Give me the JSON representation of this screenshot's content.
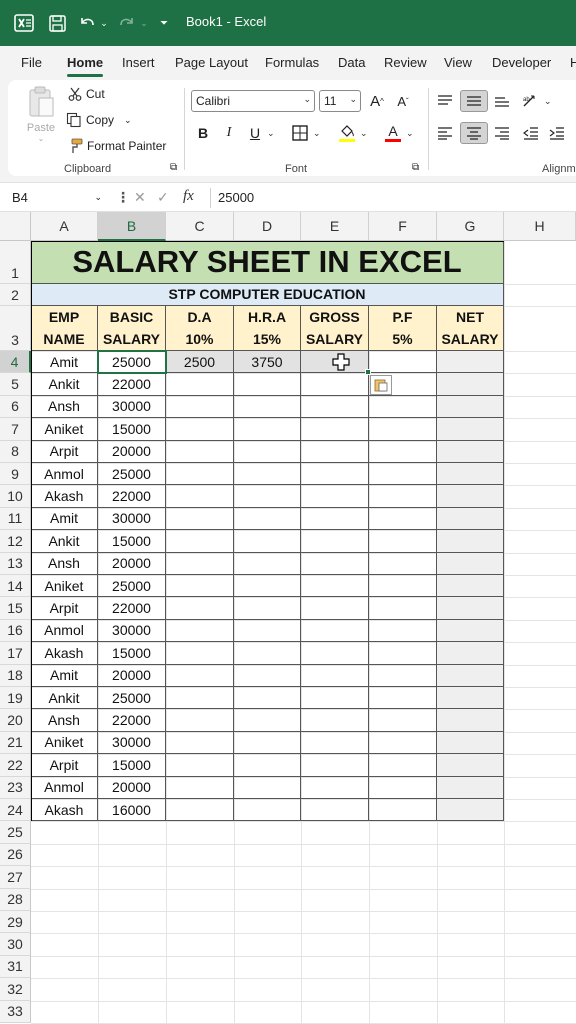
{
  "titlebar": {
    "title": "Book1  -  Excel"
  },
  "menu": {
    "tabs": [
      "File",
      "Home",
      "Insert",
      "Page Layout",
      "Formulas",
      "Data",
      "Review",
      "View",
      "Developer",
      "H"
    ]
  },
  "ribbon": {
    "clipboard": {
      "paste": "Paste",
      "cut": "Cut",
      "copy": "Copy",
      "format_painter": "Format Painter",
      "label": "Clipboard"
    },
    "font": {
      "font_name": "Calibri",
      "font_size": "11",
      "label": "Font",
      "bold": "B",
      "italic": "I",
      "underline": "U",
      "font_color_letter": "A"
    },
    "alignment_label": "Alignm"
  },
  "formula_bar": {
    "name_box": "B4",
    "fx": "fx",
    "value": "25000"
  },
  "columns": [
    "A",
    "B",
    "C",
    "D",
    "E",
    "F",
    "G",
    "H"
  ],
  "rows": [
    "1",
    "2",
    "3",
    "4",
    "5",
    "6",
    "7",
    "8",
    "9",
    "10",
    "11",
    "12",
    "13",
    "14",
    "15",
    "16",
    "17",
    "18",
    "19",
    "20",
    "21",
    "22",
    "23",
    "24",
    "25",
    "26",
    "27",
    "28",
    "29",
    "30",
    "31",
    "32",
    "33"
  ],
  "sheet": {
    "title": "SALARY SHEET IN EXCEL",
    "subtitle": "STP COMPUTER EDUCATION",
    "headers": [
      [
        "EMP",
        "NAME"
      ],
      [
        "BASIC",
        "SALARY"
      ],
      [
        "D.A",
        "10%"
      ],
      [
        "H.R.A",
        "15%"
      ],
      [
        "GROSS",
        "SALARY"
      ],
      [
        "P.F",
        "5%"
      ],
      [
        "NET",
        "SALARY"
      ]
    ],
    "data": [
      [
        "Amit",
        "25000",
        "2500",
        "3750"
      ],
      [
        "Ankit",
        "22000",
        "",
        ""
      ],
      [
        "Ansh",
        "30000",
        "",
        ""
      ],
      [
        "Aniket",
        "15000",
        "",
        ""
      ],
      [
        "Arpit",
        "20000",
        "",
        ""
      ],
      [
        "Anmol",
        "25000",
        "",
        ""
      ],
      [
        "Akash",
        "22000",
        "",
        ""
      ],
      [
        "Amit",
        "30000",
        "",
        ""
      ],
      [
        "Ankit",
        "15000",
        "",
        ""
      ],
      [
        "Ansh",
        "20000",
        "",
        ""
      ],
      [
        "Aniket",
        "25000",
        "",
        ""
      ],
      [
        "Arpit",
        "22000",
        "",
        ""
      ],
      [
        "Anmol",
        "30000",
        "",
        ""
      ],
      [
        "Akash",
        "15000",
        "",
        ""
      ],
      [
        "Amit",
        "20000",
        "",
        ""
      ],
      [
        "Ankit",
        "25000",
        "",
        ""
      ],
      [
        "Ansh",
        "22000",
        "",
        ""
      ],
      [
        "Aniket",
        "30000",
        "",
        ""
      ],
      [
        "Arpit",
        "15000",
        "",
        ""
      ],
      [
        "Anmol",
        "20000",
        "",
        ""
      ],
      [
        "Akash",
        "16000",
        "",
        ""
      ]
    ]
  },
  "colors": {
    "excel_green": "#1e7145",
    "title_fill": "#c4dfb2",
    "subtitle_fill": "#deebf7",
    "header_fill": "#fff2cc"
  }
}
